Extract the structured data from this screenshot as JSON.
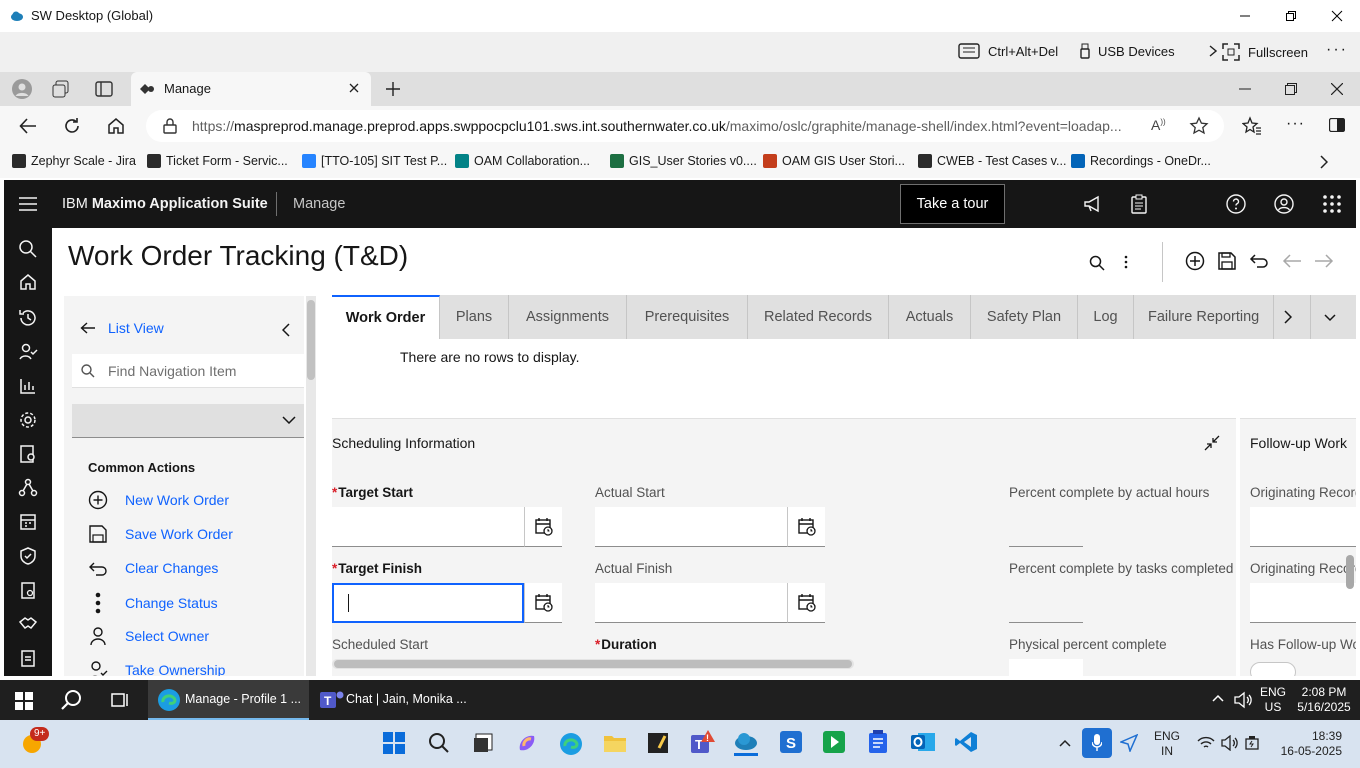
{
  "window": {
    "title": "SW Desktop (Global)"
  },
  "sw_toolbar": {
    "ctrl_alt_del": "Ctrl+Alt+Del",
    "usb": "USB Devices",
    "fullscreen": "Fullscreen"
  },
  "browser": {
    "tab_title": "Manage",
    "url_host": "maspreprod.manage.preprod.apps.swppocpclu101.sws.int.southernwater.co.uk",
    "url_path": "/maximo/oslc/graphite/manage-shell/index.html?event=loadap...",
    "url_scheme": "https://"
  },
  "favorites": [
    {
      "label": "Zephyr Scale - Jira",
      "color": "#2b2b2b"
    },
    {
      "label": "Ticket Form - Servic...",
      "color": "#2b2b2b"
    },
    {
      "label": "[TTO-105] SIT Test P...",
      "color": "#2684ff"
    },
    {
      "label": "OAM Collaboration...",
      "color": "#038387"
    },
    {
      "label": "GIS_User Stories v0....",
      "color": "#1d6f42"
    },
    {
      "label": "OAM GIS User Stori...",
      "color": "#c43e1c"
    },
    {
      "label": "CWEB - Test Cases v...",
      "color": "#2b2b2b"
    },
    {
      "label": "Recordings - OneDr...",
      "color": "#0364b8"
    }
  ],
  "app": {
    "brand_prefix": "IBM ",
    "brand_name": "Maximo Application Suite",
    "module": "Manage",
    "tour": "Take a tour",
    "page_title": "Work Order Tracking (T&D)"
  },
  "sidebar": {
    "list_view": "List View",
    "find_placeholder": "Find Navigation Item",
    "common_actions": "Common Actions",
    "actions": [
      {
        "label": "New Work Order",
        "icon": "add-circle-icon"
      },
      {
        "label": "Save Work Order",
        "icon": "save-icon"
      },
      {
        "label": "Clear Changes",
        "icon": "undo-icon"
      },
      {
        "label": "Change Status",
        "icon": "overflow-vertical-icon"
      },
      {
        "label": "Select Owner",
        "icon": "user-icon"
      },
      {
        "label": "Take Ownership",
        "icon": "user-check-icon"
      }
    ]
  },
  "tabs": [
    "Work Order",
    "Plans",
    "Assignments",
    "Prerequisites",
    "Related Records",
    "Actuals",
    "Safety Plan",
    "Log",
    "Failure Reporting"
  ],
  "active_tab": "Work Order",
  "table_empty": "There are no rows to display.",
  "scheduling": {
    "title": "Scheduling Information",
    "target_start": "Target Start",
    "target_finish": "Target Finish",
    "actual_start": "Actual Start",
    "actual_finish": "Actual Finish",
    "scheduled_start": "Scheduled Start",
    "duration": "Duration",
    "pct_hours": "Percent complete by actual hours",
    "pct_tasks": "Percent complete by tasks completed",
    "pct_physical": "Physical percent complete"
  },
  "followup": {
    "title": "Follow-up Work",
    "orig_record1": "Originating Record",
    "orig_record2": "Originating Record",
    "has_followup": "Has Follow-up Wo"
  },
  "taskbar": {
    "edge_task": "Manage - Profile 1 ...",
    "teams_task": "Chat | Jain, Monika ...",
    "lang": "ENG",
    "region": "US",
    "time": "2:08 PM",
    "date": "5/16/2025"
  },
  "win11": {
    "badge": "9+",
    "lang": "ENG",
    "region": "IN",
    "time": "18:39",
    "date": "16-05-2025"
  },
  "colors": {
    "ibm_blue": "#0f62fe",
    "header_bg": "#161616",
    "required": "#da1e28"
  }
}
